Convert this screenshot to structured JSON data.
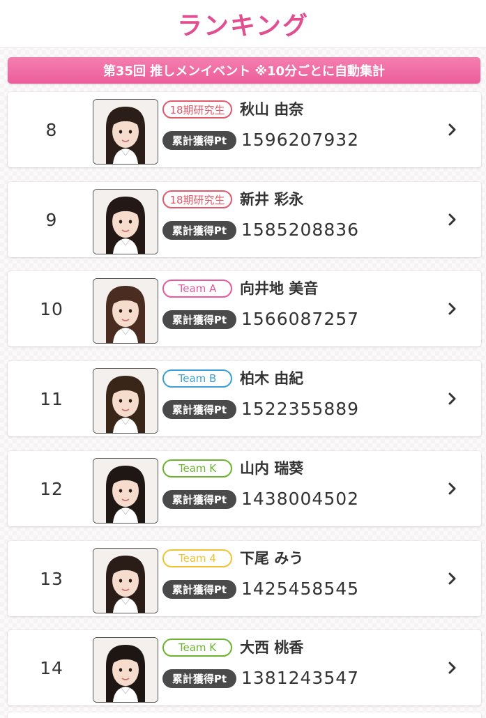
{
  "header": {
    "title": "ランキング"
  },
  "event": {
    "title": "第35回 推しメンイベント ※10分ごとに自動集計"
  },
  "pt_label": "累計獲得Pt",
  "colors": {
    "accent": "#e04f8f",
    "team_a": "#e8589e",
    "team_b": "#3a9fd8",
    "team_k": "#6ab42d",
    "team_4": "#f2c232",
    "trainee": "#e05a6a",
    "pt_badge": "#4a4a4a"
  },
  "ranking": [
    {
      "rank": "8",
      "team": "18期研究生",
      "team_key": "trainee",
      "name": "秋山 由奈",
      "points": "1596207932",
      "photo_icon": "member-photo"
    },
    {
      "rank": "9",
      "team": "18期研究生",
      "team_key": "trainee",
      "name": "新井 彩永",
      "points": "1585208836",
      "photo_icon": "member-photo"
    },
    {
      "rank": "10",
      "team": "Team A",
      "team_key": "team_a",
      "name": "向井地 美音",
      "points": "1566087257",
      "photo_icon": "member-photo"
    },
    {
      "rank": "11",
      "team": "Team B",
      "team_key": "team_b",
      "name": "柏木 由紀",
      "points": "1522355889",
      "photo_icon": "member-photo"
    },
    {
      "rank": "12",
      "team": "Team K",
      "team_key": "team_k",
      "name": "山内 瑞葵",
      "points": "1438004502",
      "photo_icon": "member-photo"
    },
    {
      "rank": "13",
      "team": "Team 4",
      "team_key": "team_4",
      "name": "下尾 みう",
      "points": "1425458545",
      "photo_icon": "member-photo"
    },
    {
      "rank": "14",
      "team": "Team K",
      "team_key": "team_k",
      "name": "大西 桃香",
      "points": "1381243547",
      "photo_icon": "member-photo"
    }
  ]
}
